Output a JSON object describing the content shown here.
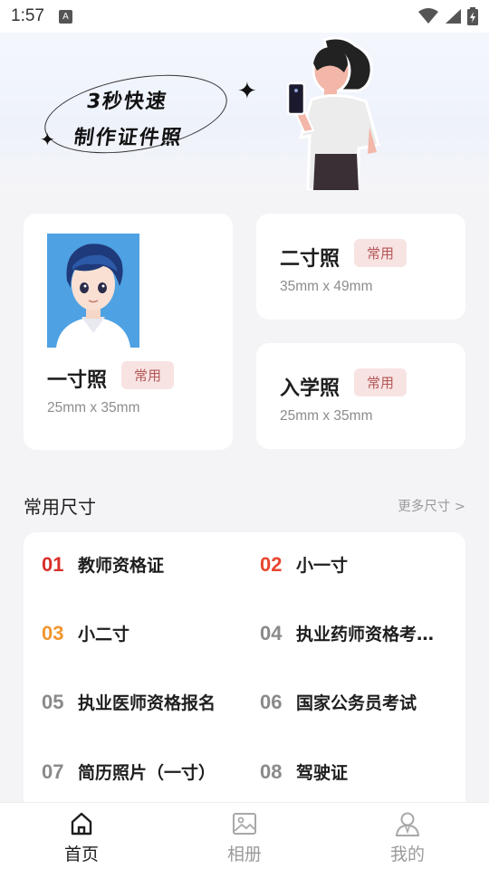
{
  "status_bar": {
    "time": "1:57",
    "notification_icon": "A"
  },
  "banner": {
    "line1": "3秒快速",
    "line2": "制作证件照"
  },
  "cards": [
    {
      "title": "一寸照",
      "tag": "常用",
      "size": "25mm x 35mm"
    },
    {
      "title": "二寸照",
      "tag": "常用",
      "size": "35mm x 49mm"
    },
    {
      "title": "入学照",
      "tag": "常用",
      "size": "25mm x 35mm"
    }
  ],
  "common_sizes": {
    "title": "常用尺寸",
    "more": "更多尺寸 >",
    "items": [
      {
        "num": "01",
        "label": "教师资格证",
        "color": "#d9302c"
      },
      {
        "num": "02",
        "label": "小一寸",
        "color": "#e8452e"
      },
      {
        "num": "03",
        "label": "小二寸",
        "color": "#f0962e"
      },
      {
        "num": "04",
        "label": "执业药师资格考…",
        "color": "#8a8a8a"
      },
      {
        "num": "05",
        "label": "执业医师资格报名",
        "color": "#8a8a8a"
      },
      {
        "num": "06",
        "label": "国家公务员考试",
        "color": "#8a8a8a"
      },
      {
        "num": "07",
        "label": "简历照片（一寸）",
        "color": "#8a8a8a"
      },
      {
        "num": "08",
        "label": "驾驶证",
        "color": "#8a8a8a"
      }
    ]
  },
  "nav": [
    {
      "label": "首页",
      "icon": "home-icon",
      "active": true
    },
    {
      "label": "相册",
      "icon": "album-icon",
      "active": false
    },
    {
      "label": "我的",
      "icon": "profile-icon",
      "active": false
    }
  ],
  "colors": {
    "tag_bg": "#f8e3e3",
    "tag_text": "#b45656",
    "nav_active": "#1e1e1e",
    "nav_inactive": "#9a9a9a"
  }
}
